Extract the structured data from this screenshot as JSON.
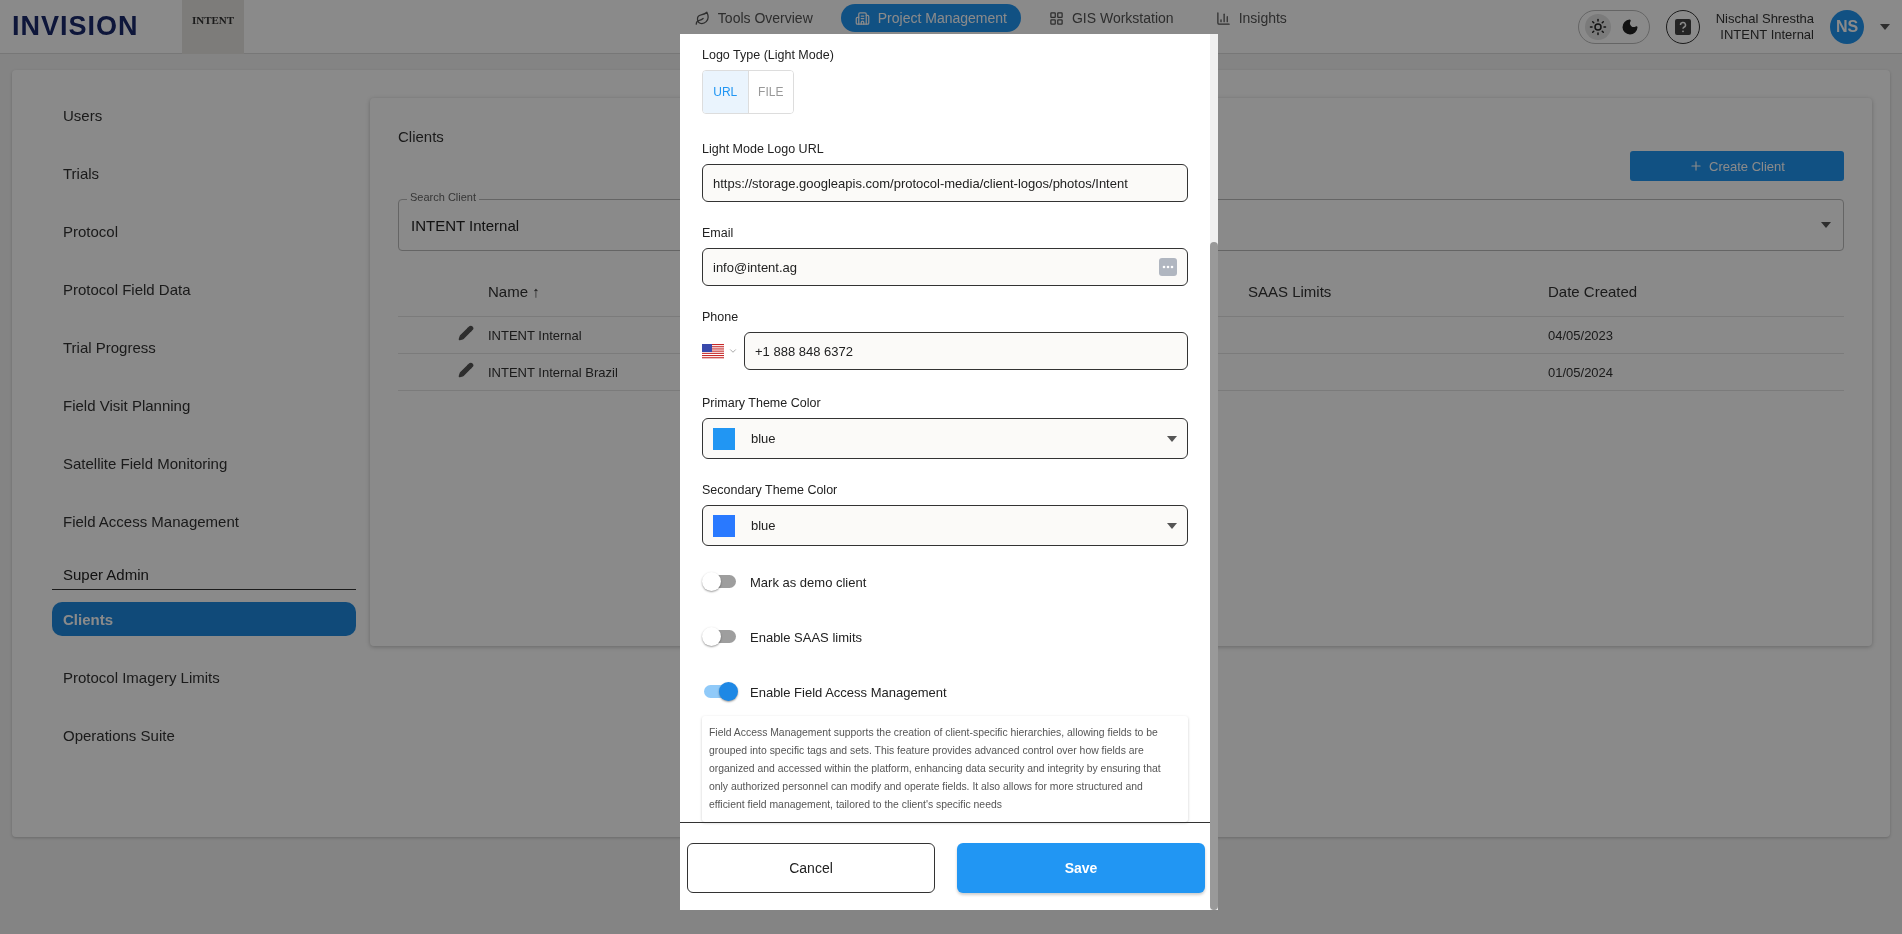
{
  "header": {
    "logo": "INVISION",
    "client_logo": "INTENT",
    "nav": [
      {
        "label": "Tools Overview",
        "selected": false
      },
      {
        "label": "Project Management",
        "selected": true
      },
      {
        "label": "GIS Workstation",
        "selected": false
      },
      {
        "label": "Insights",
        "selected": false
      }
    ],
    "theme": {
      "dark_mode": false
    },
    "user": {
      "name": "Nischal Shrestha",
      "org": "INTENT Internal",
      "initials": "NS"
    }
  },
  "sidebar": {
    "items": [
      {
        "label": "Users",
        "kind": "item",
        "selected": false
      },
      {
        "label": "Trials",
        "kind": "item",
        "selected": false
      },
      {
        "label": "Protocol",
        "kind": "item",
        "selected": false
      },
      {
        "label": "Protocol Field Data",
        "kind": "item",
        "selected": false
      },
      {
        "label": "Trial Progress",
        "kind": "item",
        "selected": false
      },
      {
        "label": "Field Visit Planning",
        "kind": "item",
        "selected": false
      },
      {
        "label": "Satellite Field Monitoring",
        "kind": "item",
        "selected": false
      },
      {
        "label": "Field Access Management",
        "kind": "item",
        "selected": false
      },
      {
        "label": "Super Admin",
        "kind": "section"
      },
      {
        "label": "Clients",
        "kind": "item",
        "selected": true
      },
      {
        "label": "Protocol Imagery Limits",
        "kind": "item",
        "selected": false
      },
      {
        "label": "Operations Suite",
        "kind": "item",
        "selected": false
      }
    ]
  },
  "clients": {
    "title": "Clients",
    "create_button": "Create Client",
    "search": {
      "label": "Search Client",
      "value": "INTENT Internal"
    },
    "table": {
      "columns": [
        "Name ↑",
        "SAAS Limits",
        "Date Created"
      ],
      "rows": [
        {
          "name": "INTENT Internal",
          "date": "04/05/2023"
        },
        {
          "name": "INTENT Internal Brazil",
          "date": "01/05/2024"
        }
      ]
    }
  },
  "modal": {
    "logo_type": {
      "label": "Logo Type (Light Mode)",
      "options": [
        {
          "label": "URL",
          "selected": true
        },
        {
          "label": "FILE",
          "selected": false
        }
      ]
    },
    "fields": [
      {
        "kind": "text",
        "label": "Light Mode Logo URL",
        "value": "https://storage.googleapis.com/protocol-media/client-logos/photos/Intent"
      },
      {
        "kind": "email",
        "label": "Email",
        "value": "info@intent.ag"
      },
      {
        "kind": "phone",
        "label": "Phone",
        "value": "+1 888 848 6372"
      },
      {
        "kind": "color",
        "label": "Primary Theme Color",
        "value": "blue",
        "color": "#2196f3"
      },
      {
        "kind": "color",
        "label": "Secondary Theme Color",
        "value": "blue",
        "color": "#2979ff"
      }
    ],
    "switches": [
      {
        "label": "Mark as demo client",
        "on": false
      },
      {
        "label": "Enable SAAS limits",
        "on": false
      },
      {
        "label": "Enable Field Access Management",
        "on": true
      }
    ],
    "description": "Field Access Management supports the creation of client-specific hierarchies, allowing fields to be grouped into specific tags and sets. This feature provides advanced control over how fields are organized and accessed within the platform, enhancing data security and integrity by ensuring that only authorized personnel can modify and operate fields. It also allows for more structured and efficient field management, tailored to the client's specific needs",
    "buttons": {
      "cancel": "Cancel",
      "save": "Save"
    }
  }
}
